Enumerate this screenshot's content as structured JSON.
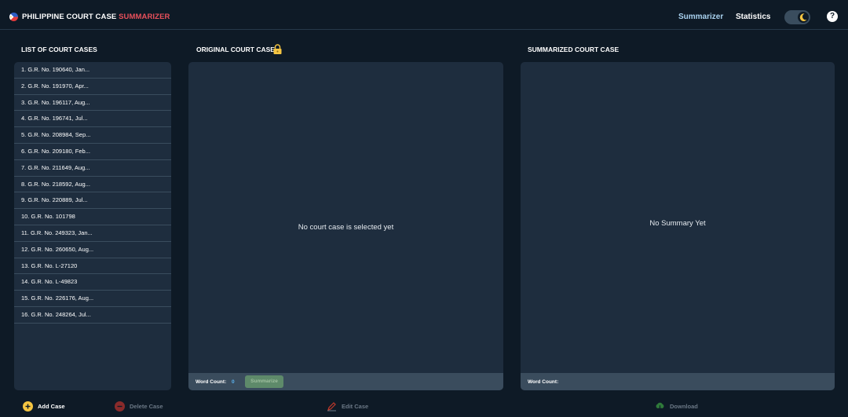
{
  "header": {
    "title_main": "PHILIPPINE COURT CASE ",
    "title_accent": "SUMMARIZER",
    "nav": {
      "summarizer": "Summarizer",
      "statistics": "Statistics"
    },
    "help": "?"
  },
  "list": {
    "title": "LIST OF COURT CASES",
    "items": [
      "1. G.R. No. 190640, Jan...",
      "2. G.R. No. 191970, Apr...",
      "3. G.R. No. 196117, Aug...",
      "4. G.R. No. 196741, Jul...",
      "5. G.R. No. 208984, Sep...",
      "6. G.R. No. 209180, Feb...",
      "7. G.R. No. 211649, Aug...",
      "8. G.R. No. 218592, Aug...",
      "9. G.R. No. 220889, Jul...",
      "10. G.R. No. 101798",
      "11. G.R. No. 249323, Jan...",
      "12. G.R. No. 260650, Aug...",
      "13. G.R. No. L-27120",
      "14. G.R. No. L-49823",
      "15. G.R. No. 226176, Aug...",
      "16. G.R. No. 248264, Jul..."
    ]
  },
  "original": {
    "title": "ORIGINAL COURT CASE",
    "empty": "No court case is selected yet",
    "word_count_label": "Word Count:",
    "word_count_value": "0",
    "summarize": "Summarize"
  },
  "summary": {
    "title": "SUMMARIZED COURT CASE",
    "empty": "No Summary Yet",
    "word_count_label": "Word Count:"
  },
  "actions": {
    "add": "Add Case",
    "delete": "Delete Case",
    "edit": "Edit Case",
    "download": "Download"
  },
  "colors": {
    "background": "#0e1a26",
    "panel": "#1e2d3e",
    "accent_red": "#e8505b",
    "nav_active": "#a9d2f0",
    "count_blue": "#5bb3f0",
    "add_yellow": "#f5c542",
    "delete_red": "#c0392b",
    "download_green": "#3e8e4a"
  }
}
